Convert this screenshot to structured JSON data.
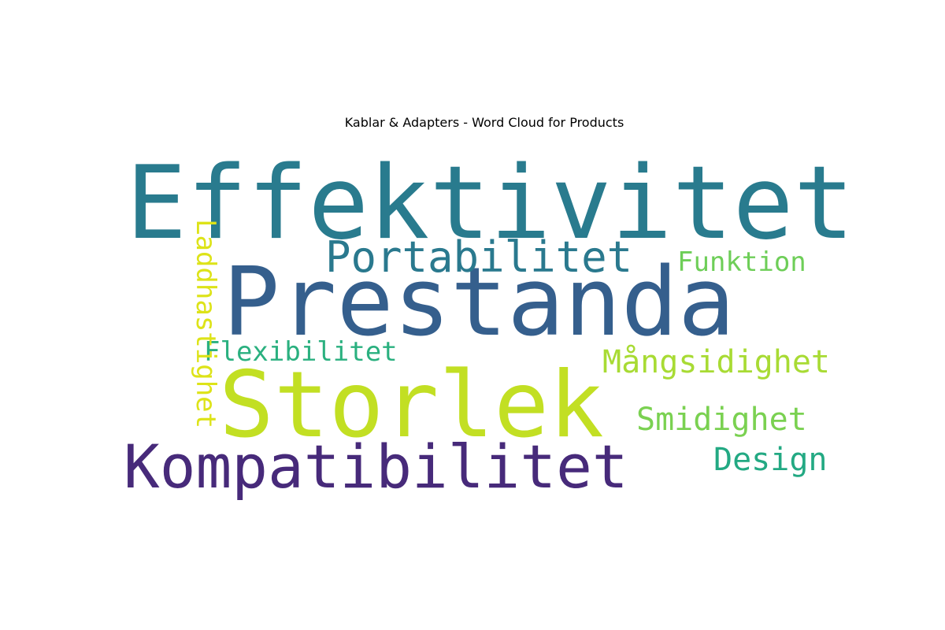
{
  "chart_data": {
    "type": "wordcloud",
    "title": "Kablar & Adapters - Word Cloud for Products",
    "words": [
      {
        "text": "Effektivitet",
        "weight": 1.0,
        "color": "#297b8e"
      },
      {
        "text": "Prestanda",
        "weight": 0.92,
        "color": "#355f8d"
      },
      {
        "text": "Storlek",
        "weight": 0.88,
        "color": "#c2df23"
      },
      {
        "text": "Kompatibilitet",
        "weight": 0.68,
        "color": "#472a7a"
      },
      {
        "text": "Portabilitet",
        "weight": 0.45,
        "color": "#2a798e"
      },
      {
        "text": "Mångsidighet",
        "weight": 0.4,
        "color": "#a8db34"
      },
      {
        "text": "Smidighet",
        "weight": 0.4,
        "color": "#7ad151"
      },
      {
        "text": "Design",
        "weight": 0.4,
        "color": "#23a983"
      },
      {
        "text": "Flexibilitet",
        "weight": 0.35,
        "color": "#2ab07f"
      },
      {
        "text": "Funktion",
        "weight": 0.35,
        "color": "#6ece58"
      },
      {
        "text": "Laddhastighet",
        "weight": 0.35,
        "color": "#dde318"
      }
    ]
  }
}
